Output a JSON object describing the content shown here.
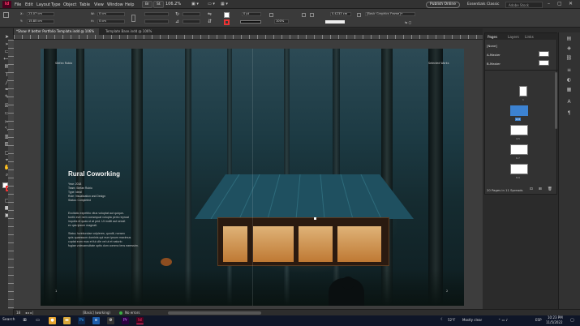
{
  "app": {
    "logo": "Id"
  },
  "menu": [
    "File",
    "Edit",
    "Layout",
    "Type",
    "Object",
    "Table",
    "View",
    "Window",
    "Help"
  ],
  "menubar_extra": {
    "bridge": "Br",
    "stock": "St",
    "zoom": "106.2%",
    "publish": "Publish Online",
    "workspace": "Essentials Classic",
    "search": "Adobe Stock"
  },
  "control": {
    "x": "23.07 cm",
    "y": "15.85 cm",
    "w": "0 cm",
    "h": "0 cm",
    "stroke_weight": "0 pt",
    "opacity": "100%",
    "gap": "0.4233 cm",
    "frame_style": "[Basic Graphics Frame]+"
  },
  "tabs": {
    "active": "*Show # better Portfolio Template.indd @ 106%",
    "inactive": "Template Base.indd @ 106%"
  },
  "spread": {
    "running_head_left": "Stefan Rubio",
    "running_head_right": "Selected Works",
    "title": "Rural Coworking",
    "meta": [
      "Year: 2018",
      "Team: Stefan Rubio",
      "Type: Ideal",
      "Role: Visualization and Design",
      "Status: Completed"
    ],
    "body": [
      "Excitatio expetitio vitus voluptat aut quique-",
      "tuntin eve nem consequat volupta peris reproat",
      "inquies et quas ut at ped. Ut mollit aut sessit",
      "ex qas ipsum magnati.",
      "Statur, turintundae volpieres, qundit, nonsec",
      "quis quaessum dominis qui eum ipsum maximus",
      "cuptat eum mus et fui ulle vel ut et naturio",
      "fugiae volecarnultate optis dum commo lens earessim."
    ],
    "folio_left": "1",
    "folio_right": "2"
  },
  "pages_panel": {
    "tabs": [
      "Pages",
      "Layers",
      "Links"
    ],
    "masters": [
      "[None]",
      "A-Master",
      "B-Master"
    ],
    "thumb_labels": [
      "1",
      "2-3",
      "4-5",
      "6-7",
      "8-9"
    ],
    "status": "20 Pages in 11 Spreads"
  },
  "status": {
    "page": "18",
    "layout": "[Basic] (working)",
    "preflight": "No errors"
  },
  "taskbar": {
    "search": "Search",
    "weather": "52°F",
    "weather_text": "Mostly clear",
    "lang": "ESP",
    "time": "10:23 PM",
    "date": "11/5/2022"
  },
  "colors": {
    "accent": "#ff3366",
    "selection": "#3c82d1",
    "indesign_bg": "#49021f"
  }
}
